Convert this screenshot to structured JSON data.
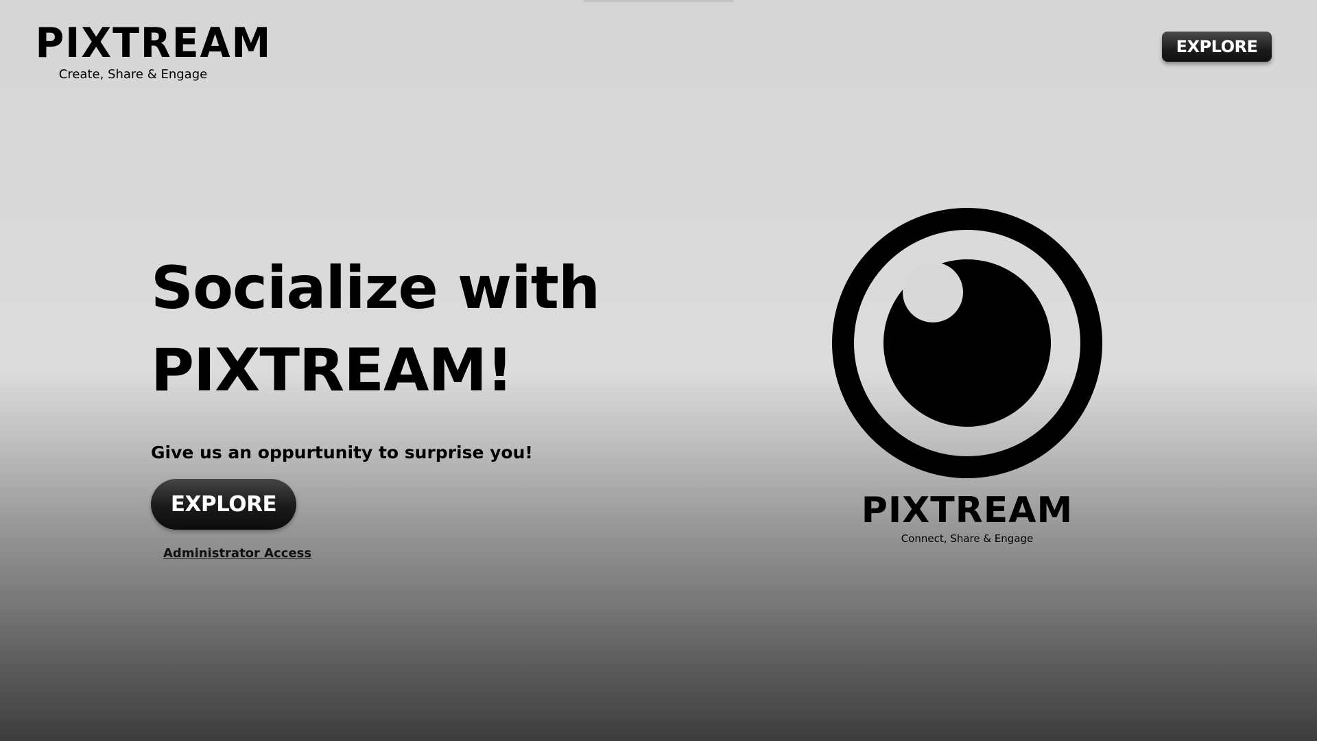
{
  "header": {
    "logo_text": "PIXTREAM",
    "tagline": "Create, Share & Engage",
    "explore_label": "EXPLORE"
  },
  "hero": {
    "title_line1": "Socialize with",
    "title_line2": "PIXTREAM!",
    "subtitle": "Give us an oppurtunity to surprise you!",
    "explore_label": "EXPLORE",
    "admin_link": "Administrator Access"
  },
  "emblem": {
    "icon": "eye-camera-icon",
    "logo_text": "PIXTREAM",
    "tagline": "Connect, Share & Engage"
  },
  "colors": {
    "button_bg": "#1a1a1a",
    "button_text": "#ffffff",
    "text": "#000000"
  }
}
